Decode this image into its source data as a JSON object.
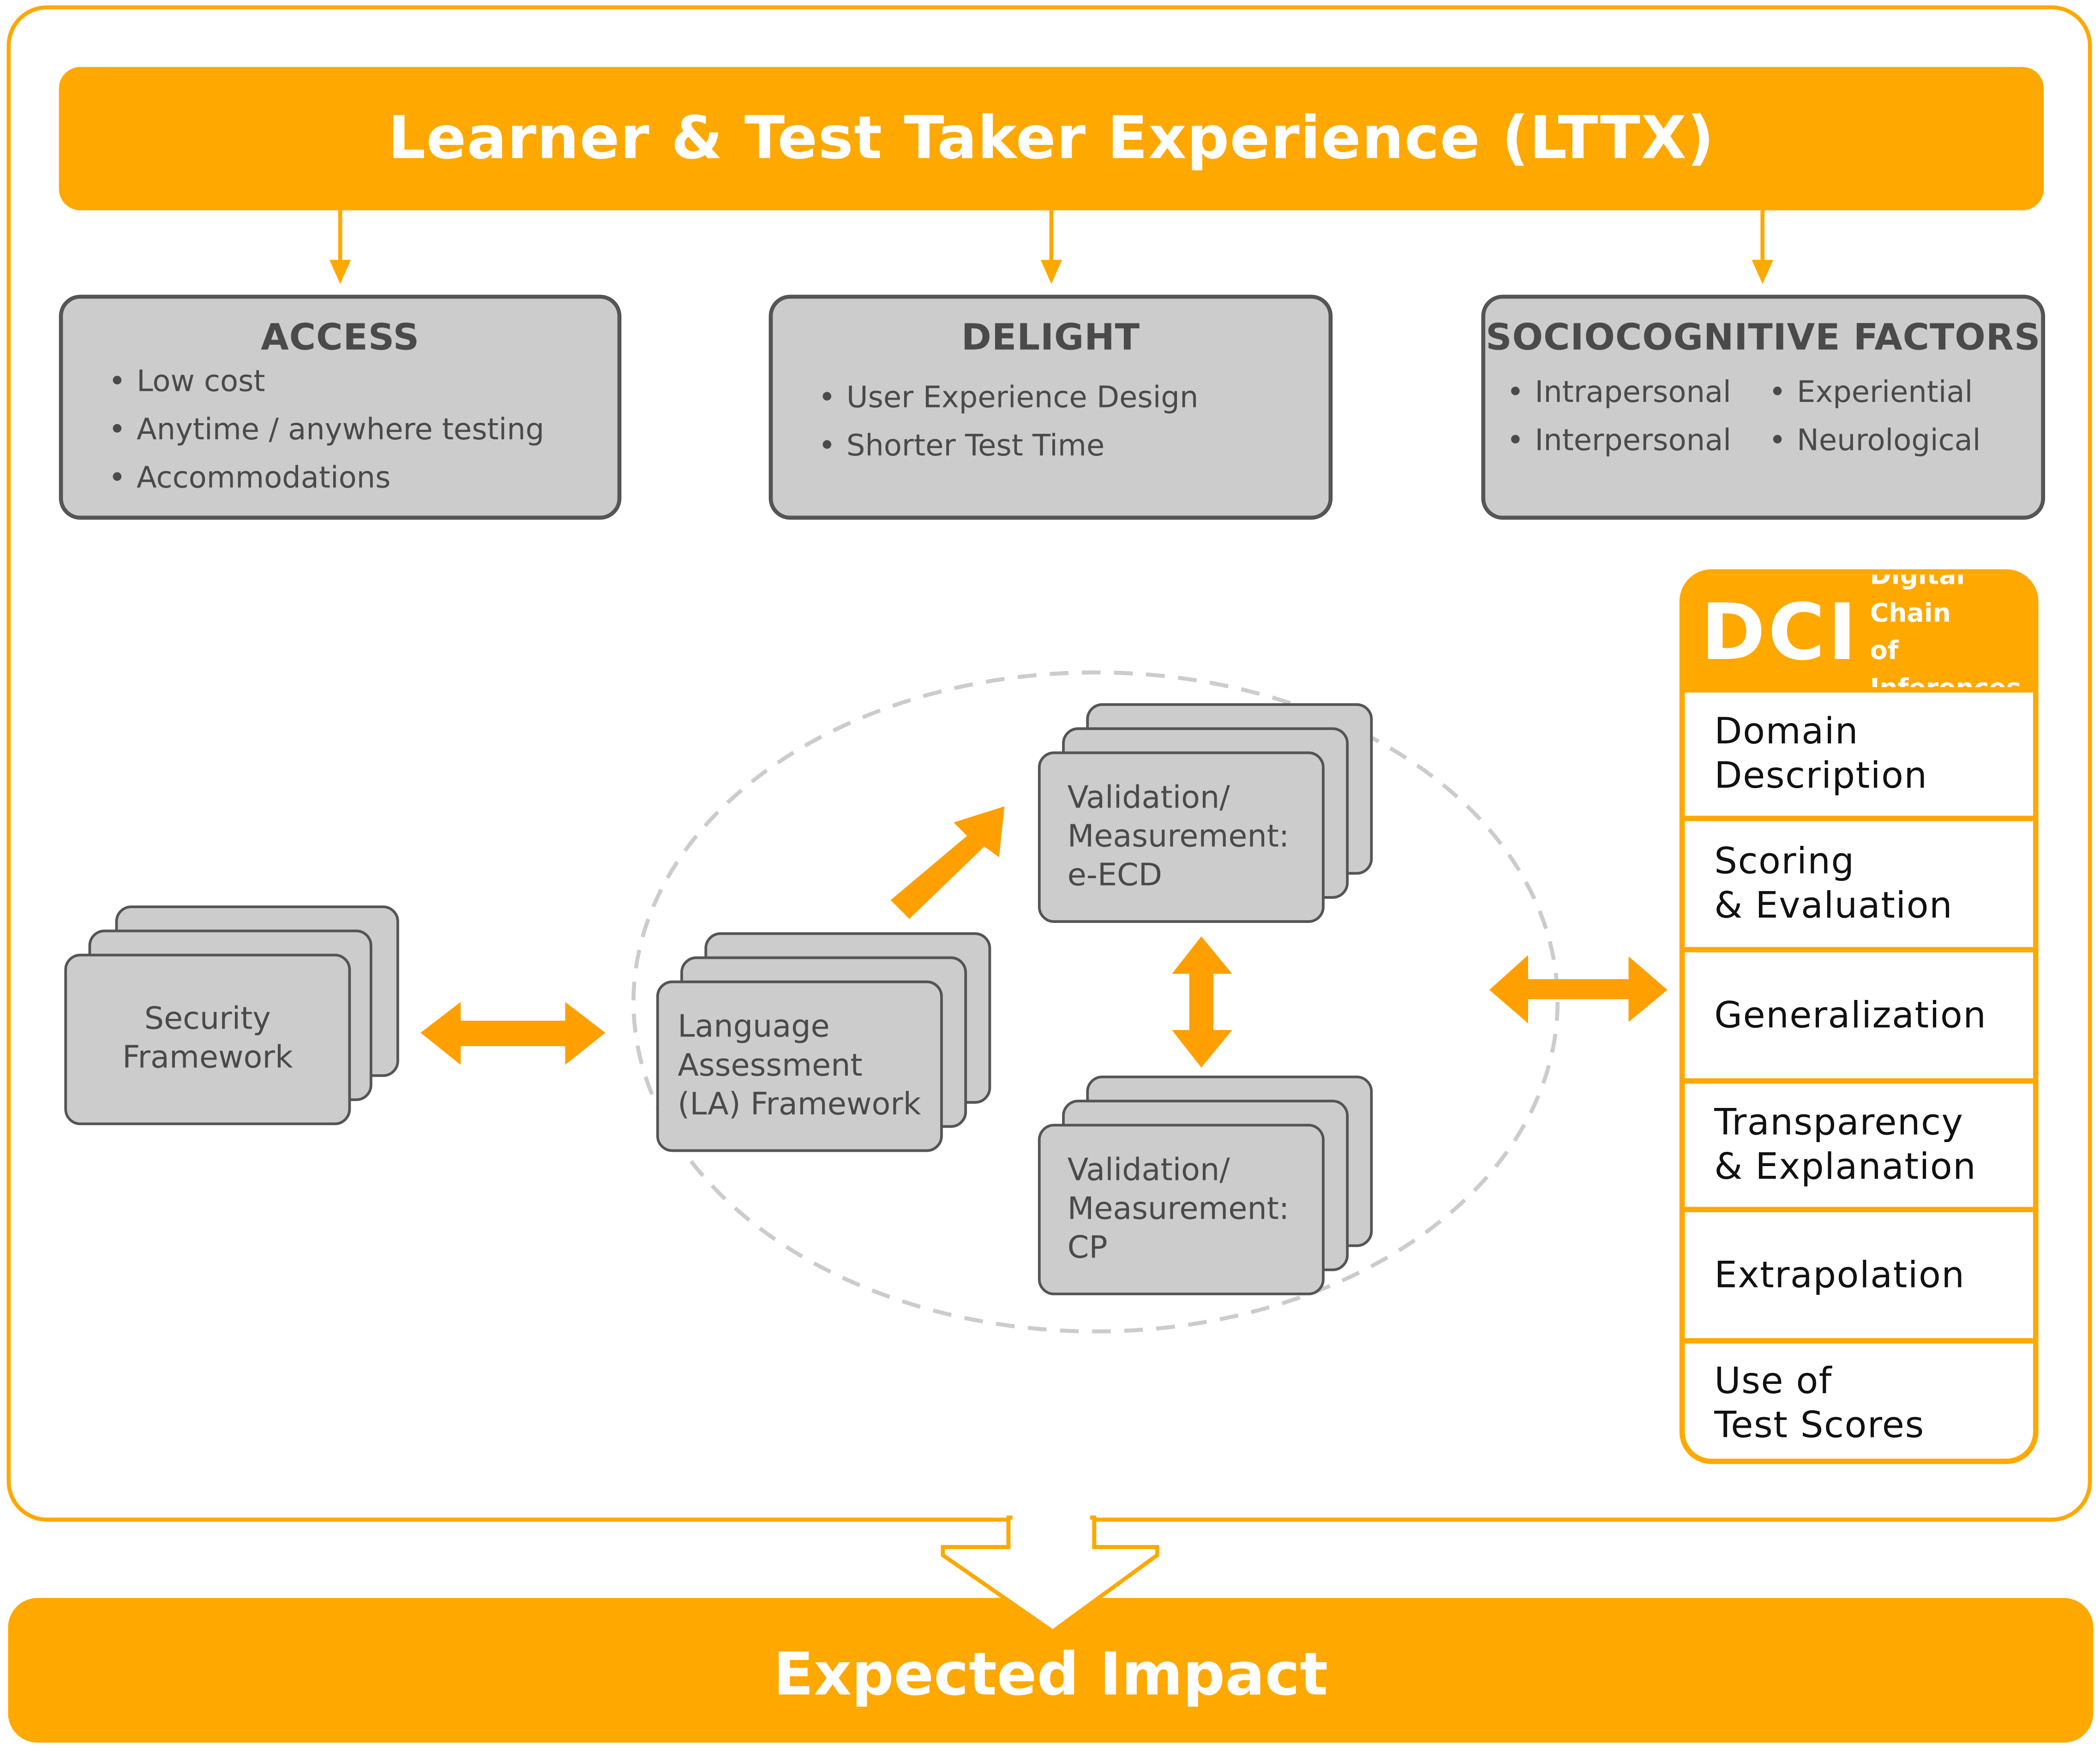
{
  "header": {
    "title": "Learner & Test Taker Experience (LTTX)"
  },
  "factors": {
    "access": {
      "title": "ACCESS",
      "items": [
        "Low cost",
        "Anytime / anywhere testing",
        "Accommodations"
      ]
    },
    "delight": {
      "title": "DELIGHT",
      "items": [
        "User Experience Design",
        "Shorter Test Time"
      ]
    },
    "sociocognitive": {
      "title": "SOCIOCOGNITIVE FACTORS",
      "items_col1": [
        "Intrapersonal",
        "Interpersonal"
      ],
      "items_col2": [
        "Experiential",
        "Neurological"
      ]
    }
  },
  "frameworks": {
    "security": {
      "line1": "Security",
      "line2": "Framework"
    },
    "language_assessment": {
      "line1": "Language",
      "line2": "Assessment",
      "line3": "(LA) Framework"
    },
    "validation_eecd": {
      "line1": "Validation/",
      "line2": "Measurement:",
      "line3": "e-ECD"
    },
    "validation_cp": {
      "line1": "Validation/",
      "line2": "Measurement:",
      "line3": "CP"
    }
  },
  "dci": {
    "abbr": "DCI",
    "subtitle_line1": "Digital Chain",
    "subtitle_line2": "of Inferences",
    "inferences": [
      {
        "line1": "Domain",
        "line2": "Description"
      },
      {
        "line1": "Scoring",
        "line2": "& Evaluation"
      },
      {
        "line1": "Generalization",
        "line2": ""
      },
      {
        "line1": "Transparency",
        "line2": "& Explanation"
      },
      {
        "line1": "Extrapolation",
        "line2": ""
      },
      {
        "line1": "Use of",
        "line2": "Test Scores"
      }
    ]
  },
  "footer": {
    "title": "Expected Impact"
  },
  "colors": {
    "accent": "#FFA800",
    "arrow": "#FFA000",
    "card_fill": "#CCCCCC",
    "card_border": "#555555",
    "text_dark": "#4A4A4A",
    "ellipse_dash": "#CCCCCC"
  }
}
